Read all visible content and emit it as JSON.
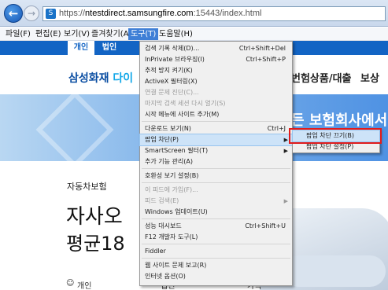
{
  "browser": {
    "url_prefix": "https://",
    "url_host": "ntestdirect.samsungfire.com",
    "url_path": ":15443/index.html"
  },
  "menubar": [
    "파일(F)",
    "편집(E)",
    "보기(V)",
    "즐겨찾기(A)",
    "도구(T)",
    "도움말(H)"
  ],
  "site": {
    "tab_personal": "개인",
    "tab_corporate": "법인",
    "logo_main": "삼성화재",
    "logo_sub": "다이",
    "nav_1": "번험상품/대출",
    "nav_2": "보상",
    "banner_text": "든 보험회사에서 ",
    "product_label": "자동차보험",
    "headline_1": "자사오",
    "headline_2": "평균18",
    "bottom_tab_1": "개인",
    "bottom_tab_2": "법인",
    "bottom_tab_3": "가족"
  },
  "tools_menu": [
    {
      "label": "검색 기록 삭제(D)...",
      "shortcut": "Ctrl+Shift+Del",
      "submenu": false,
      "disabled": false,
      "hover": false
    },
    {
      "label": "InPrivate 브라우징(I)",
      "shortcut": "Ctrl+Shift+P",
      "submenu": false,
      "disabled": false,
      "hover": false
    },
    {
      "label": "추적 방지 켜기(K)",
      "shortcut": "",
      "submenu": false,
      "disabled": false,
      "hover": false
    },
    {
      "label": "ActiveX 필터링(X)",
      "shortcut": "",
      "submenu": false,
      "disabled": false,
      "hover": false
    },
    {
      "label": "연결 문제 진단(C)...",
      "shortcut": "",
      "submenu": false,
      "disabled": true,
      "hover": false
    },
    {
      "label": "마지막 검색 세션 다시 열기(S)",
      "shortcut": "",
      "submenu": false,
      "disabled": true,
      "hover": false
    },
    {
      "label": "시작 메뉴에 사이트 추가(M)",
      "shortcut": "",
      "submenu": false,
      "disabled": false,
      "hover": false
    },
    {
      "label": "다운로드 보기(N)",
      "shortcut": "Ctrl+J",
      "submenu": false,
      "disabled": false,
      "hover": false
    },
    {
      "label": "팝업 차단(P)",
      "shortcut": "",
      "submenu": true,
      "disabled": false,
      "hover": true
    },
    {
      "label": "SmartScreen 필터(T)",
      "shortcut": "",
      "submenu": true,
      "disabled": false,
      "hover": false
    },
    {
      "label": "추가 기능 관리(A)",
      "shortcut": "",
      "submenu": false,
      "disabled": false,
      "hover": false
    },
    {
      "label": "호환성 보기 설정(B)",
      "shortcut": "",
      "submenu": false,
      "disabled": false,
      "hover": false
    },
    {
      "label": "이 피드에 가입(F)...",
      "shortcut": "",
      "submenu": false,
      "disabled": true,
      "hover": false
    },
    {
      "label": "피드 검색(E)",
      "shortcut": "",
      "submenu": true,
      "disabled": true,
      "hover": false
    },
    {
      "label": "Windows 업데이트(U)",
      "shortcut": "",
      "submenu": false,
      "disabled": false,
      "hover": false
    },
    {
      "label": "성능 대시보드",
      "shortcut": "Ctrl+Shift+U",
      "submenu": false,
      "disabled": false,
      "hover": false
    },
    {
      "label": "F12 개발자 도구(L)",
      "shortcut": "",
      "submenu": false,
      "disabled": false,
      "hover": false
    },
    {
      "label": "Fiddler",
      "shortcut": "",
      "submenu": false,
      "disabled": false,
      "hover": false
    },
    {
      "label": "웹 사이트 문제 보고(R)",
      "shortcut": "",
      "submenu": false,
      "disabled": false,
      "hover": false
    },
    {
      "label": "인터넷 옵션(O)",
      "shortcut": "",
      "submenu": false,
      "disabled": false,
      "hover": false
    }
  ],
  "popup_submenu": [
    {
      "label": "팝업 차단 끄기(B)",
      "hover": true
    },
    {
      "label": "팝업 차단 설정(P)",
      "hover": false
    }
  ],
  "colors": {
    "highlight_box": "#e11c1c",
    "menu_hover": "#cde3f8",
    "brand_blue": "#1264c4"
  }
}
